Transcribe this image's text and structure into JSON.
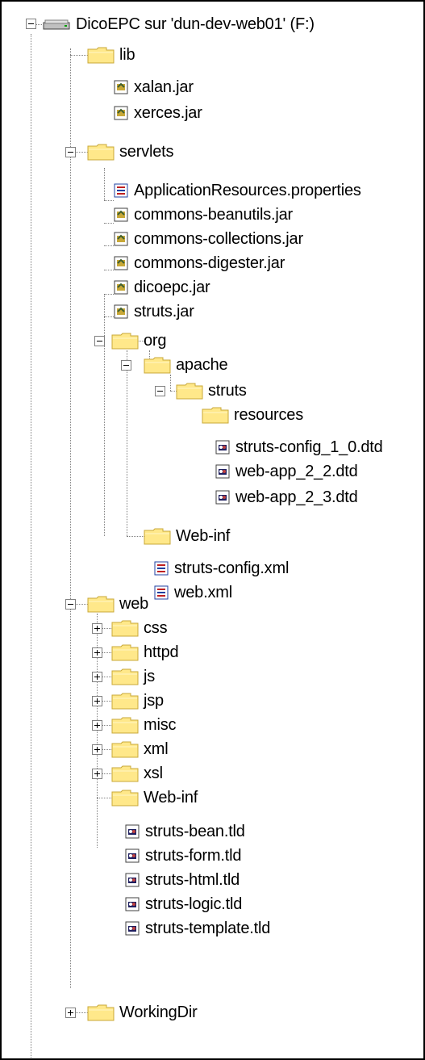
{
  "root": {
    "label": "DicoEPC sur 'dun-dev-web01' (F:)",
    "icon": "network-drive-icon",
    "expanded": true
  },
  "nodes": [
    {
      "id": "lib",
      "label": "lib",
      "type": "folder",
      "expanded": true
    },
    {
      "id": "xalan",
      "label": "xalan.jar",
      "type": "jar"
    },
    {
      "id": "xerces",
      "label": "xerces.jar",
      "type": "jar"
    },
    {
      "id": "servlets",
      "label": "servlets",
      "type": "folder",
      "expanded": true
    },
    {
      "id": "appres",
      "label": "ApplicationResources.properties",
      "type": "properties"
    },
    {
      "id": "beanutils",
      "label": "commons-beanutils.jar",
      "type": "jar"
    },
    {
      "id": "collections",
      "label": "commons-collections.jar",
      "type": "jar"
    },
    {
      "id": "digester",
      "label": "commons-digester.jar",
      "type": "jar"
    },
    {
      "id": "dicoepc",
      "label": "dicoepc.jar",
      "type": "jar"
    },
    {
      "id": "strutsjar",
      "label": "struts.jar",
      "type": "jar"
    },
    {
      "id": "org",
      "label": "org",
      "type": "folder",
      "expanded": true
    },
    {
      "id": "apache",
      "label": "apache",
      "type": "folder",
      "expanded": true
    },
    {
      "id": "struts",
      "label": "struts",
      "type": "folder",
      "expanded": true
    },
    {
      "id": "resources",
      "label": "resources",
      "type": "folder",
      "expanded": true
    },
    {
      "id": "dtd10",
      "label": "struts-config_1_0.dtd",
      "type": "dtd"
    },
    {
      "id": "dtd22",
      "label": "web-app_2_2.dtd",
      "type": "dtd"
    },
    {
      "id": "dtd23",
      "label": "web-app_2_3.dtd",
      "type": "dtd"
    },
    {
      "id": "webinf1",
      "label": "Web-inf",
      "type": "folder",
      "expanded": true
    },
    {
      "id": "strutsconfig",
      "label": "struts-config.xml",
      "type": "xml"
    },
    {
      "id": "webxml",
      "label": "web.xml",
      "type": "xml"
    },
    {
      "id": "web",
      "label": "web",
      "type": "folder",
      "expanded": true
    },
    {
      "id": "css",
      "label": "css",
      "type": "folder",
      "expanded": false
    },
    {
      "id": "httpd",
      "label": "httpd",
      "type": "folder",
      "expanded": false
    },
    {
      "id": "js",
      "label": "js",
      "type": "folder",
      "expanded": false
    },
    {
      "id": "jsp",
      "label": "jsp",
      "type": "folder",
      "expanded": false
    },
    {
      "id": "misc",
      "label": "misc",
      "type": "folder",
      "expanded": false
    },
    {
      "id": "xml",
      "label": "xml",
      "type": "folder",
      "expanded": false
    },
    {
      "id": "xsl",
      "label": "xsl",
      "type": "folder",
      "expanded": false
    },
    {
      "id": "webinf2",
      "label": "Web-inf",
      "type": "folder",
      "expanded": true
    },
    {
      "id": "tldbean",
      "label": "struts-bean.tld",
      "type": "tld"
    },
    {
      "id": "tldform",
      "label": "struts-form.tld",
      "type": "tld"
    },
    {
      "id": "tldhtml",
      "label": "struts-html.tld",
      "type": "tld"
    },
    {
      "id": "tldlogic",
      "label": "struts-logic.tld",
      "type": "tld"
    },
    {
      "id": "tldtemplate",
      "label": "struts-template.tld",
      "type": "tld"
    },
    {
      "id": "workingdir",
      "label": "WorkingDir",
      "type": "folder",
      "expanded": false
    }
  ],
  "colors": {
    "folder": "#ffe88a",
    "folder_shade": "#c8a838",
    "line": "#808080"
  }
}
